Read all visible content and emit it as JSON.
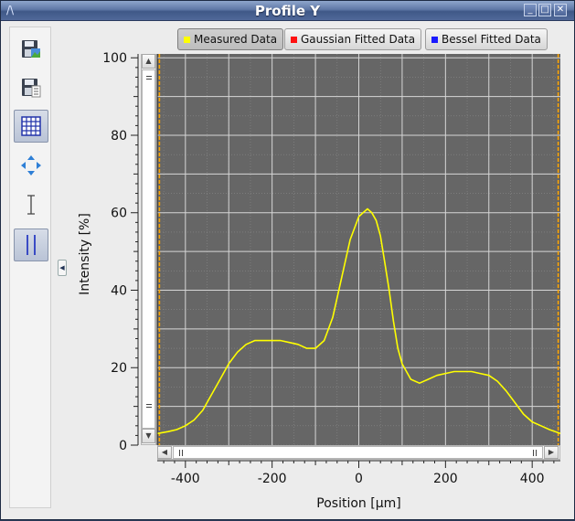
{
  "window": {
    "title": "Profile Y"
  },
  "toolbar": {
    "items": [
      {
        "name": "save-image-icon"
      },
      {
        "name": "save-data-icon"
      },
      {
        "name": "grid-icon",
        "active": true
      },
      {
        "name": "pan-arrows-icon"
      },
      {
        "name": "text-cursor-icon"
      },
      {
        "name": "cursors-icon",
        "active": true
      }
    ]
  },
  "legend": {
    "items": [
      {
        "label": "Measured Data",
        "color": "#ffff00",
        "pressed": true
      },
      {
        "label": "Gaussian Fitted Data",
        "color": "#ff1111",
        "pressed": false
      },
      {
        "label": "Bessel Fitted Data",
        "color": "#1a1aff",
        "pressed": false
      }
    ]
  },
  "chart_data": {
    "type": "line",
    "title": "",
    "xlabel": "Position [µm]",
    "ylabel": "Intensity [%]",
    "xlim": [
      -465,
      465
    ],
    "ylim": [
      0,
      101
    ],
    "xticks": [
      -400,
      -200,
      0,
      200,
      400
    ],
    "yticks": [
      0,
      20,
      40,
      60,
      80,
      100
    ],
    "grid": true,
    "background": "#666666",
    "cursor_color": "#ffa500",
    "cursors_x": [
      -460,
      460
    ],
    "series": [
      {
        "name": "Measured Data",
        "color": "#ffff00",
        "x": [
          -465,
          -440,
          -420,
          -400,
          -380,
          -360,
          -340,
          -320,
          -300,
          -280,
          -260,
          -240,
          -220,
          -200,
          -180,
          -160,
          -140,
          -120,
          -100,
          -80,
          -60,
          -40,
          -20,
          0,
          10,
          20,
          30,
          40,
          50,
          60,
          70,
          80,
          90,
          100,
          120,
          140,
          160,
          180,
          200,
          220,
          240,
          260,
          280,
          300,
          320,
          340,
          360,
          380,
          400,
          420,
          440,
          465
        ],
        "y": [
          3,
          3.5,
          4,
          5,
          6.5,
          9,
          13,
          17,
          21,
          24,
          26,
          27,
          27,
          27,
          27,
          26.5,
          26,
          25,
          25,
          27,
          33,
          43,
          53,
          59,
          60,
          61,
          60,
          58,
          54,
          47,
          40,
          32,
          25,
          21,
          17,
          16,
          17,
          18,
          18.5,
          19,
          19,
          19,
          18.5,
          18,
          16.5,
          14,
          11,
          8,
          6,
          5,
          4,
          3
        ]
      },
      {
        "name": "Gaussian Fitted Data",
        "color": "#ff1111",
        "x": [],
        "y": []
      },
      {
        "name": "Bessel Fitted Data",
        "color": "#1a1aff",
        "x": [],
        "y": []
      }
    ]
  }
}
